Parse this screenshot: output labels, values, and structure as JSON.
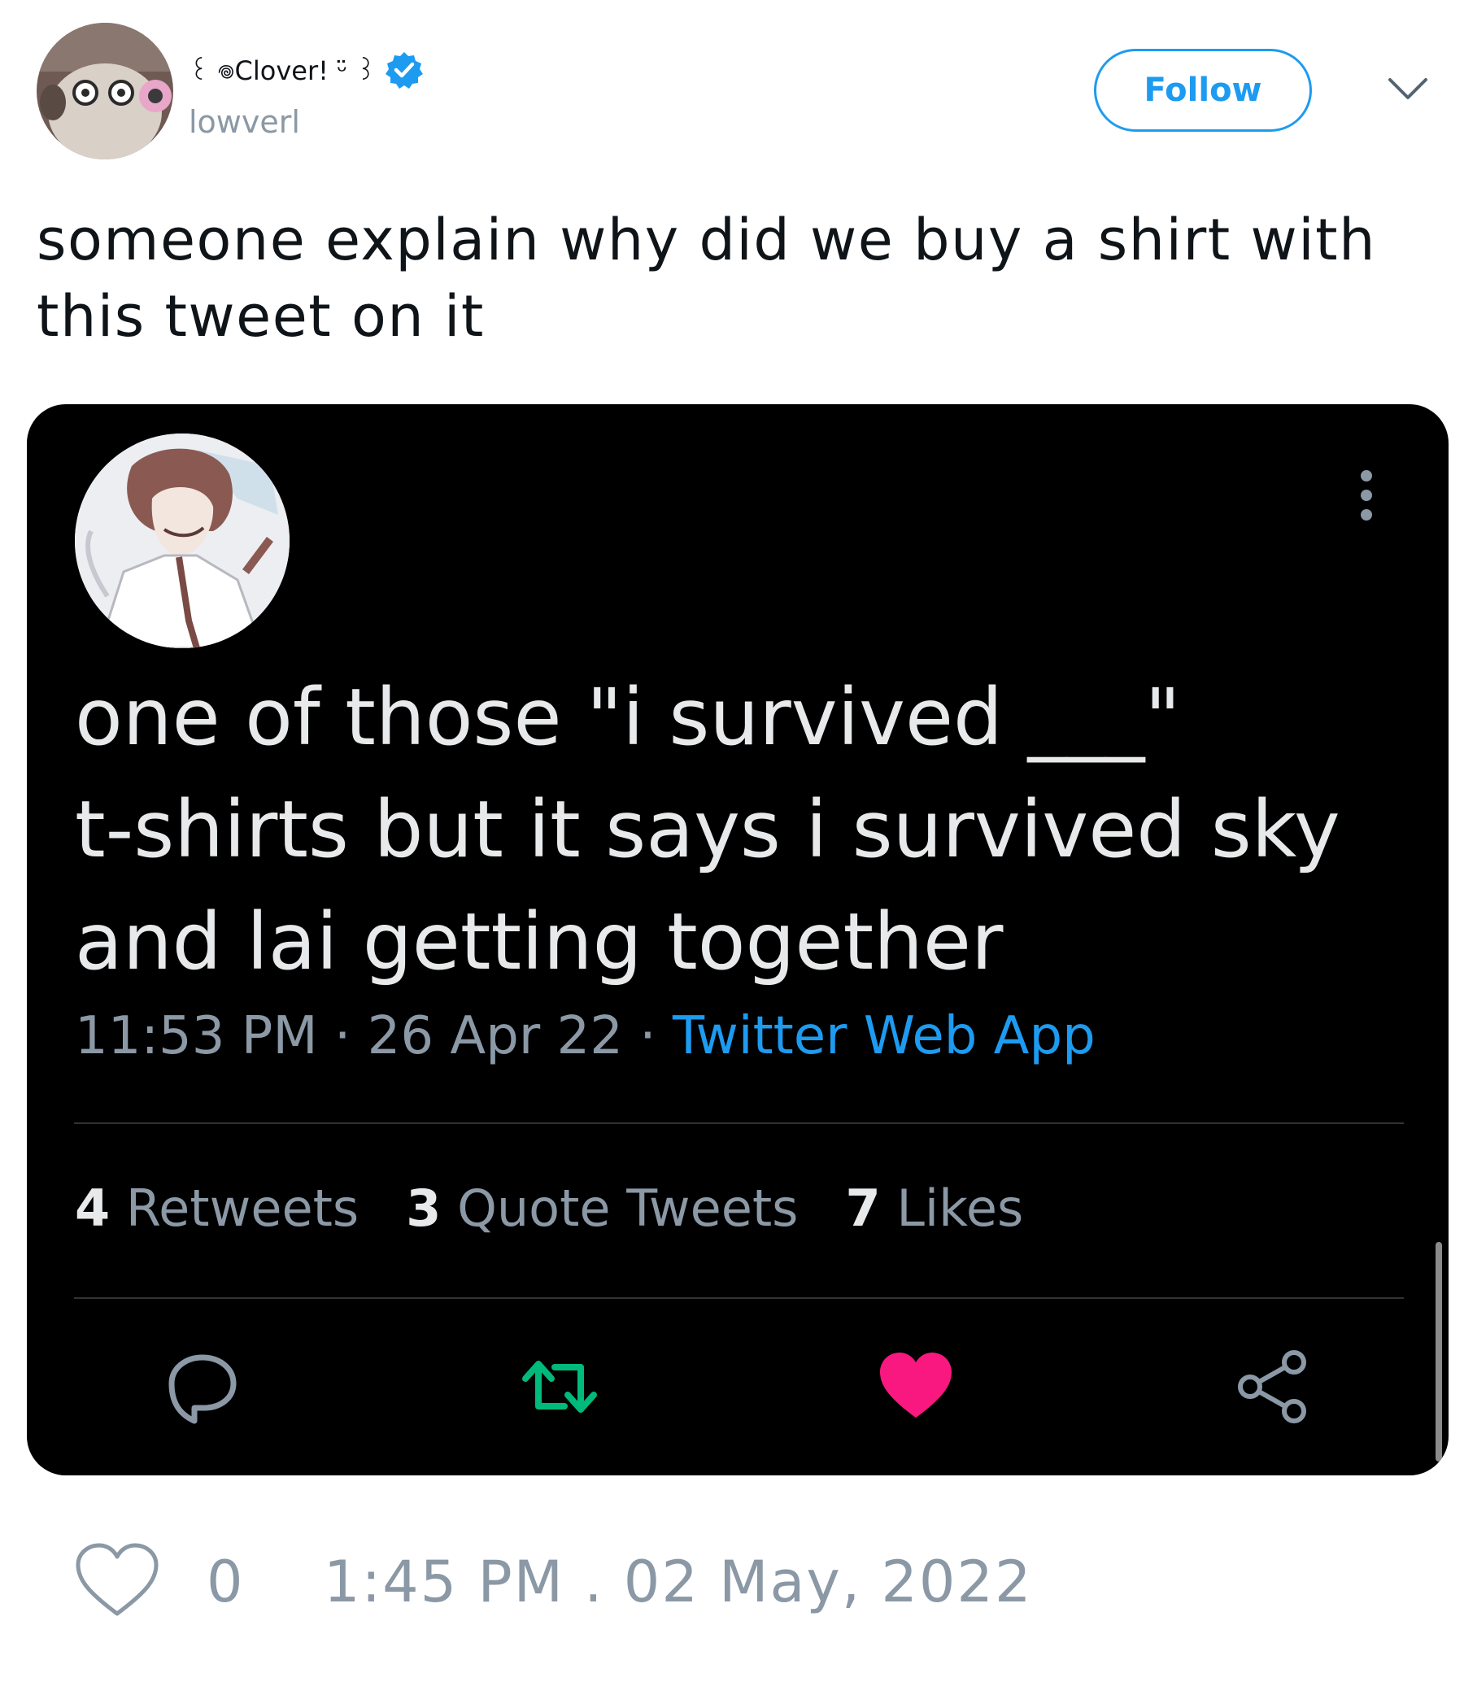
{
  "author": {
    "display_name": "꒰ 𖦹Clover! ᵕ̈ ꒱",
    "handle": "lowverl"
  },
  "header": {
    "follow_label": "Follow"
  },
  "tweet": {
    "text": "someone explain why did we buy a shirt with this tweet on it"
  },
  "embedded": {
    "text_lines": [
      "one of those \"i survived ___\"",
      "t-shirts but it says i survived sky",
      "and lai getting together"
    ],
    "time": "11:53 PM",
    "date": "26 Apr 22",
    "separator": "·",
    "source": "Twitter Web App",
    "stats": [
      {
        "count": "4",
        "label": "Retweets"
      },
      {
        "count": "3",
        "label": "Quote Tweets"
      },
      {
        "count": "7",
        "label": "Likes"
      }
    ]
  },
  "footer": {
    "like_count": "0",
    "timestamp": "1:45 PM . 02 May, 2022"
  },
  "colors": {
    "accent": "#1d9bf0",
    "retweet": "#00ba7c",
    "like": "#f91880",
    "muted": "#8b98a5"
  }
}
